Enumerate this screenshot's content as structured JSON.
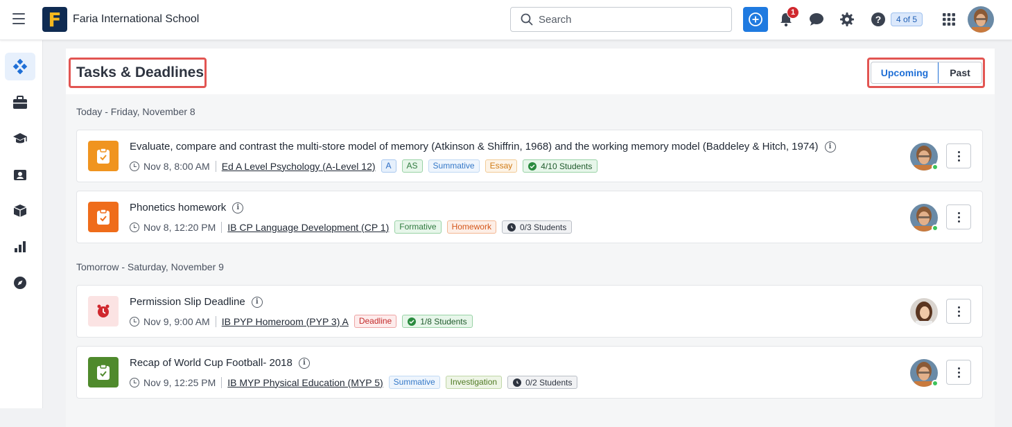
{
  "header": {
    "school_name": "Faria International School",
    "logo_letter": "F",
    "search_placeholder": "Search",
    "notification_count": "1",
    "help_progress": "4 of 5"
  },
  "sidebar": {
    "items": [
      "dashboard-icon",
      "briefcase-icon",
      "graduation-cap-icon",
      "id-card-icon",
      "cube-icon",
      "bar-chart-icon",
      "compass-icon"
    ]
  },
  "page": {
    "title": "Tasks & Deadlines",
    "tabs": {
      "upcoming": "Upcoming",
      "past": "Past"
    }
  },
  "groups": [
    {
      "heading": "Today - Friday, November 8",
      "tasks": [
        {
          "title": "Evaluate, compare and contrast the multi-store model of memory (Atkinson & Shiffrin, 1968) and the working memory model (Baddeley & Hitch, 1974)",
          "time": "Nov 8, 8:00 AM",
          "class": "Ed A Level Psychology (A-Level 12)",
          "tags": [
            "A",
            "AS",
            "Summative",
            "Essay"
          ],
          "students": "4/10 Students",
          "icon_color": "#f0941f"
        },
        {
          "title": "Phonetics homework",
          "time": "Nov 8, 12:20 PM",
          "class": "IB CP Language Development (CP 1)",
          "tags": [
            "Formative",
            "Homework"
          ],
          "students": "0/3 Students",
          "icon_color": "#ef6c1a"
        }
      ]
    },
    {
      "heading": "Tomorrow - Saturday, November 9",
      "tasks": [
        {
          "title": "Permission Slip Deadline",
          "time": "Nov 9, 9:00 AM",
          "class": "IB PYP Homeroom (PYP 3) A",
          "tags": [
            "Deadline"
          ],
          "students": "1/8 Students",
          "icon_color": "#fbe3e3"
        },
        {
          "title": "Recap of World Cup Football- 2018",
          "time": "Nov 9, 12:25 PM",
          "class": "IB MYP Physical Education (MYP 5)",
          "tags": [
            "Summative",
            "Investigation"
          ],
          "students": "0/2 Students",
          "icon_color": "#4f8a2c"
        }
      ]
    }
  ]
}
